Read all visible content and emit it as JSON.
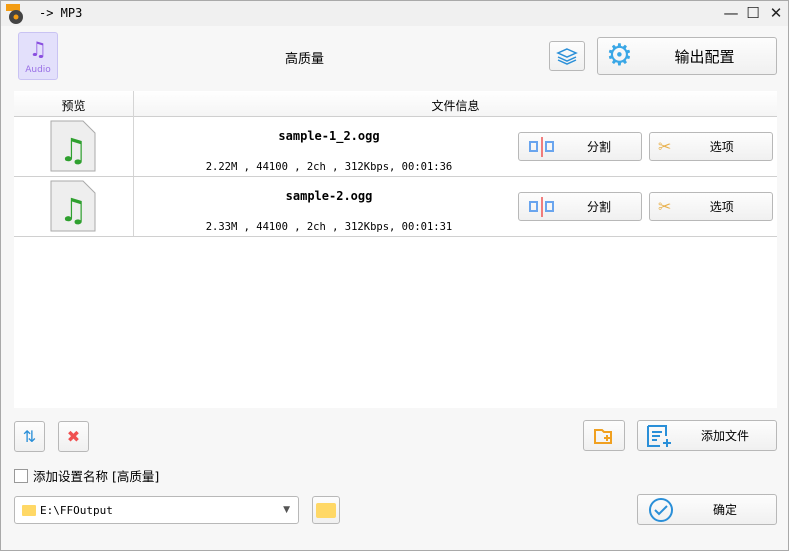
{
  "window": {
    "title": "-> MP3",
    "app_icon_label": "MP3"
  },
  "header": {
    "format_icon_label": "Audio",
    "preset": "高质量",
    "output_config": "输出配置"
  },
  "table": {
    "columns": [
      "预览",
      "文件信息"
    ],
    "rows": [
      {
        "name": "sample-1_2.ogg",
        "info": "2.22M , 44100 , 2ch , 312Kbps, 00:01:36",
        "split": "分割",
        "options": "选项"
      },
      {
        "name": "sample-2.ogg",
        "info": "2.33M , 44100 , 2ch , 312Kbps, 00:01:31",
        "split": "分割",
        "options": "选项"
      }
    ]
  },
  "footer": {
    "add_file": "添加文件",
    "checkbox_label": "添加设置名称 [高质量]",
    "checkbox_checked": false,
    "output_path": "E:\\FFOutput",
    "ok": "确定"
  }
}
